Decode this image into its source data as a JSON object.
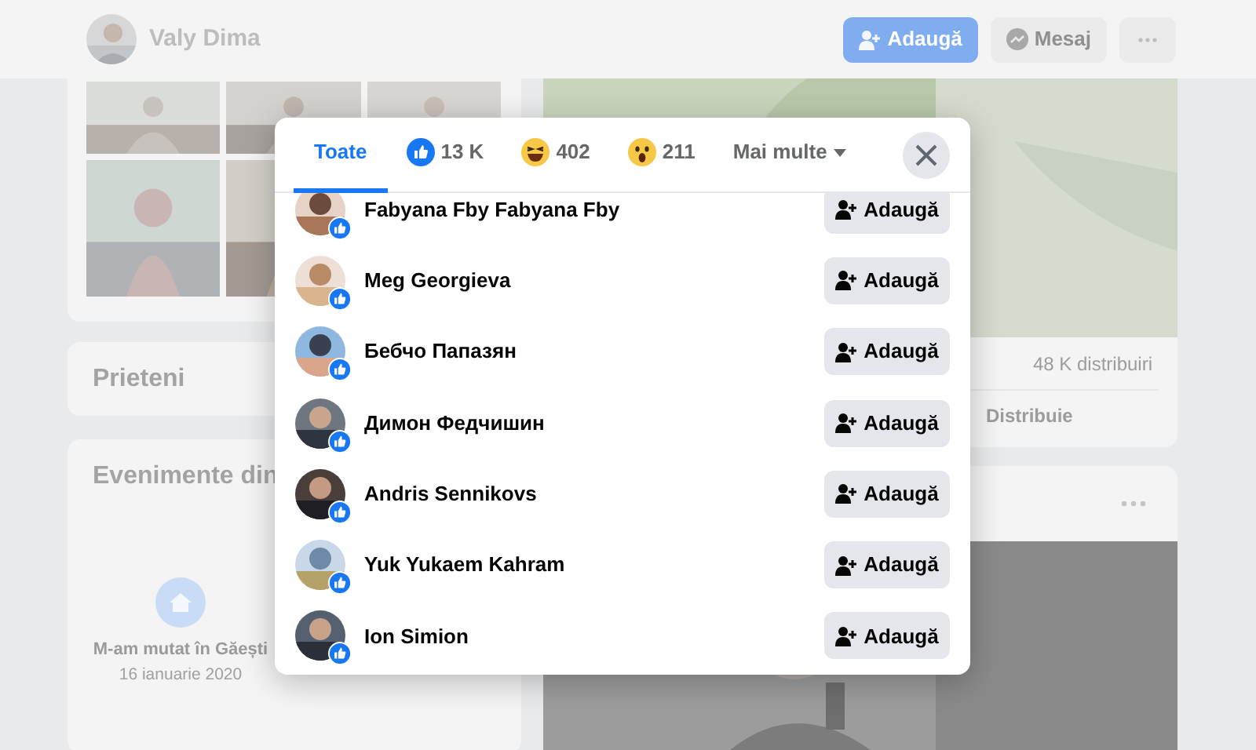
{
  "profile_header": {
    "name": "Valy Dima",
    "buttons": [
      {
        "kind": "add",
        "label": "Adaugă"
      },
      {
        "kind": "message",
        "label": "Mesaj"
      },
      {
        "kind": "more"
      }
    ]
  },
  "friends_card": {
    "title": "Prieteni"
  },
  "events_card": {
    "title": "Evenimente din",
    "event_name": "M-am mutat în Găești",
    "event_date": "16 ianuarie 2020"
  },
  "post": {
    "shares": "48 K distribuiri",
    "share_label": "Distribuie"
  },
  "reactions_dialog": {
    "tabs": [
      {
        "kind": "all",
        "label": "Toate",
        "selected": true
      },
      {
        "kind": "like",
        "label": "13 K",
        "selected": false
      },
      {
        "kind": "haha",
        "label": "402",
        "selected": false
      },
      {
        "kind": "wow",
        "label": "211",
        "selected": false
      },
      {
        "kind": "more",
        "label": "Mai multe",
        "selected": false
      }
    ],
    "people": [
      {
        "name": "Fabyana Fby Fabyana Fby",
        "button": "Adaugă"
      },
      {
        "name": "Meg Georgieva",
        "button": "Adaugă"
      },
      {
        "name": "Бебчо Папазян",
        "button": "Adaugă"
      },
      {
        "name": "Димон Федчишин",
        "button": "Adaugă"
      },
      {
        "name": "Andris Sennikovs",
        "button": "Adaugă"
      },
      {
        "name": "Yuk Yukaem Kahram",
        "button": "Adaugă"
      },
      {
        "name": "Ion Simion",
        "button": "Adaugă"
      }
    ]
  }
}
